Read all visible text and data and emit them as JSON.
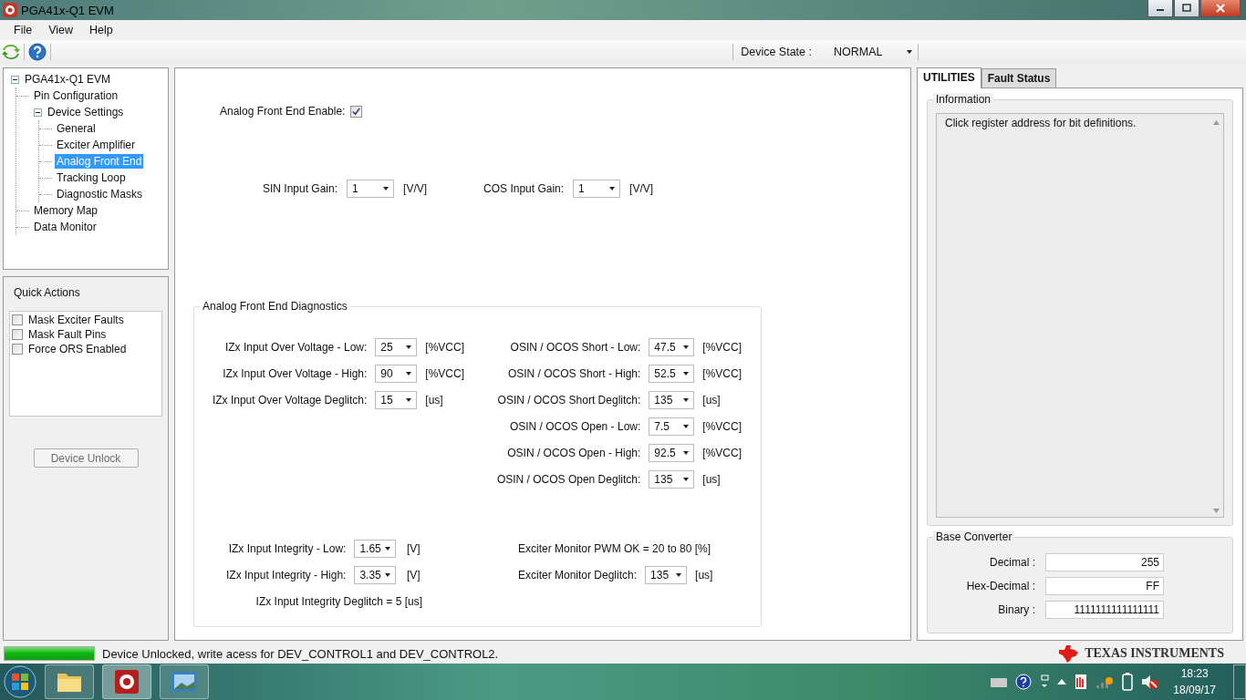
{
  "window": {
    "title": "PGA41x-Q1 EVM"
  },
  "menu": [
    "File",
    "View",
    "Help"
  ],
  "toolbar": {
    "device_state_label": "Device State :",
    "device_state": "NORMAL"
  },
  "tree": [
    {
      "label": "PGA41x-Q1 EVM",
      "selected": false,
      "expanded": true,
      "children": [
        {
          "label": "Pin Configuration",
          "selected": false
        },
        {
          "label": "Device Settings",
          "selected": false,
          "expanded": true,
          "children": [
            {
              "label": "General",
              "selected": false
            },
            {
              "label": "Exciter Amplifier",
              "selected": false
            },
            {
              "label": "Analog Front End",
              "selected": true
            },
            {
              "label": "Tracking Loop",
              "selected": false
            },
            {
              "label": "Diagnostic Masks",
              "selected": false
            }
          ]
        },
        {
          "label": "Memory Map",
          "selected": false
        },
        {
          "label": "Data Monitor",
          "selected": false
        }
      ]
    }
  ],
  "quick_actions": {
    "title": "Quick Actions",
    "items": [
      {
        "label": "Mask Exciter Faults",
        "checked": false
      },
      {
        "label": "Mask Fault Pins",
        "checked": false
      },
      {
        "label": "Force ORS Enabled",
        "checked": false
      }
    ],
    "button": "Device Unlock"
  },
  "afe": {
    "enable_label": "Analog Front End Enable:",
    "enabled": true,
    "gains": [
      {
        "label": "SIN Input Gain:",
        "value": "1",
        "unit": "[V/V]"
      },
      {
        "label": "COS Input Gain:",
        "value": "1",
        "unit": "[V/V]"
      }
    ]
  },
  "diagnostics": {
    "title": "Analog Front End Diagnostics",
    "left": [
      {
        "kind": "dropdown",
        "label": "IZx Input Over Voltage - Low:",
        "value": "25",
        "unit": "[%VCC]"
      },
      {
        "kind": "dropdown",
        "label": "IZx Input Over Voltage - High:",
        "value": "90",
        "unit": "[%VCC]"
      },
      {
        "kind": "dropdown",
        "label": "IZx Input Over Voltage Deglitch:",
        "value": "15",
        "unit": "[us]"
      }
    ],
    "right": [
      {
        "kind": "dropdown",
        "label": "OSIN / OCOS Short - Low:",
        "value": "47.5",
        "unit": "[%VCC]"
      },
      {
        "kind": "dropdown",
        "label": "OSIN / OCOS Short - High:",
        "value": "52.5",
        "unit": "[%VCC]"
      },
      {
        "kind": "dropdown",
        "label": "OSIN / OCOS Short Deglitch:",
        "value": "135",
        "unit": "[us]"
      },
      {
        "kind": "dropdown",
        "label": "OSIN / OCOS Open - Low:",
        "value": "7.5",
        "unit": "[%VCC]"
      },
      {
        "kind": "dropdown",
        "label": "OSIN / OCOS Open - High:",
        "value": "92.5",
        "unit": "[%VCC]"
      },
      {
        "kind": "dropdown",
        "label": "OSIN / OCOS Open Deglitch:",
        "value": "135",
        "unit": "[us]"
      }
    ],
    "bottom_left": [
      {
        "kind": "dropdown",
        "label": "IZx Input Integrity - Low:",
        "value": "1.65",
        "unit": "[V]"
      },
      {
        "kind": "dropdown",
        "label": "IZx Input Integrity - High:",
        "value": "3.35",
        "unit": "[V]"
      },
      {
        "kind": "text",
        "label": "IZx Input Integrity Deglitch = 5 [us]"
      }
    ],
    "bottom_right": [
      {
        "kind": "text",
        "label": "Exciter Monitor PWM OK = 20 to 80 [%]"
      },
      {
        "kind": "dropdown",
        "label": "Exciter Monitor Deglitch:",
        "value": "135",
        "unit": "[us]"
      }
    ]
  },
  "right_panel": {
    "tabs": [
      {
        "label": "UTILITIES",
        "selected": true
      },
      {
        "label": "Fault Status",
        "selected": false
      }
    ],
    "information": {
      "title": "Information",
      "text": "Click register address for bit definitions."
    },
    "base_converter": {
      "title": "Base Converter",
      "fields": [
        {
          "label": "Decimal :",
          "value": "255"
        },
        {
          "label": "Hex-Decimal :",
          "value": "FF"
        },
        {
          "label": "Binary :",
          "value": "1111111111111111"
        }
      ]
    }
  },
  "status_bar": {
    "level": 1,
    "message": "Device Unlocked, write acess for DEV_CONTROL1 and DEV_CONTROL2.",
    "logo": "TEXAS INSTRUMENTS"
  },
  "taskbar": {
    "time": "18:23",
    "date": "18/09/17"
  }
}
